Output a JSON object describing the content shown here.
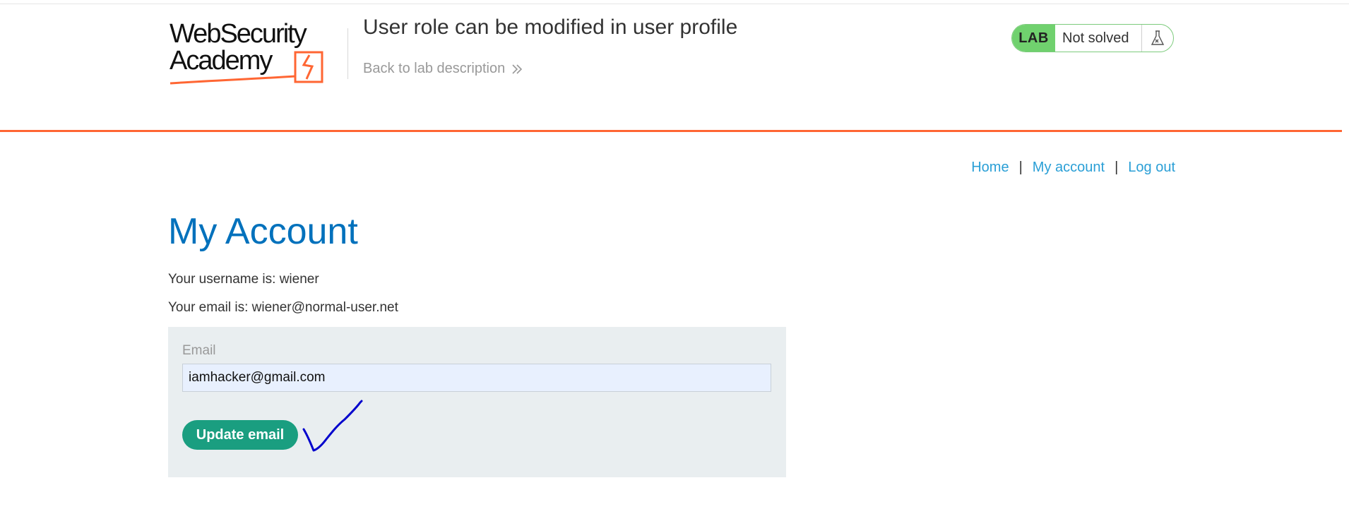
{
  "header": {
    "logo_line1": "WebSecurity",
    "logo_line2": "Academy",
    "lab_title": "User role can be modified in user profile",
    "back_link": "Back to lab description",
    "lab_badge": "LAB",
    "lab_status": "Not solved"
  },
  "nav": {
    "home": "Home",
    "separator": "|",
    "my_account": "My account",
    "log_out": "Log out"
  },
  "main": {
    "title": "My Account",
    "username_line": "Your username is: wiener",
    "email_line": "Your email is: wiener@normal-user.net",
    "form": {
      "email_label": "Email",
      "email_value": "iamhacker@gmail.com",
      "submit_label": "Update email"
    }
  },
  "colors": {
    "accent_orange": "#ff6633",
    "title_blue": "#0071bc",
    "link_blue": "#2a9fd6",
    "lab_green": "#70d16e",
    "button_green": "#1a9e80",
    "annotation_blue": "#0000cc"
  },
  "icons": {
    "back_chevron": "double-chevron-right-icon",
    "lab_flask": "flask-icon",
    "annotation": "checkmark-icon"
  }
}
